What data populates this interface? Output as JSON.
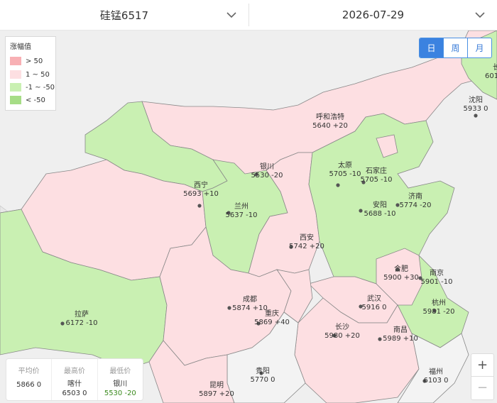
{
  "header": {
    "product": "硅锰6517",
    "date": "2026-07-29"
  },
  "legend": {
    "title": "涨幅值",
    "items": [
      {
        "label": "> 50",
        "color": "#f8b0b4"
      },
      {
        "label": "1 ~ 50",
        "color": "#fddfe2"
      },
      {
        "label": "-1 ~ -50",
        "color": "#c9f0b2"
      },
      {
        "label": "< -50",
        "color": "#a6dd86"
      }
    ]
  },
  "period_buttons": [
    {
      "label": "日",
      "active": true
    },
    {
      "label": "周",
      "active": false
    },
    {
      "label": "月",
      "active": false
    }
  ],
  "cities": [
    {
      "name": "呼和浩特",
      "price": "5640",
      "change": "+20"
    },
    {
      "name": "沈阳",
      "price": "5933",
      "change": "0"
    },
    {
      "name": "银川",
      "price": "5530",
      "change": "-20"
    },
    {
      "name": "太原",
      "price": "5705",
      "change": "-10"
    },
    {
      "name": "石家庄",
      "price": "5705",
      "change": "-10"
    },
    {
      "name": "西宁",
      "price": "5693",
      "change": "+10"
    },
    {
      "name": "济南",
      "price": "5774",
      "change": "-20"
    },
    {
      "name": "兰州",
      "price": "5637",
      "change": "-10"
    },
    {
      "name": "安阳",
      "price": "5688",
      "change": "-10"
    },
    {
      "name": "西安",
      "price": "5742",
      "change": "+20"
    },
    {
      "name": "合肥",
      "price": "5900",
      "change": "+30"
    },
    {
      "name": "南京",
      "price": "5901",
      "change": "-10"
    },
    {
      "name": "成都",
      "price": "5874",
      "change": "+10"
    },
    {
      "name": "武汉",
      "price": "5916",
      "change": "0"
    },
    {
      "name": "杭州",
      "price": "5981",
      "change": "-20"
    },
    {
      "name": "拉萨",
      "price": "6172",
      "change": "-10"
    },
    {
      "name": "重庆",
      "price": "5869",
      "change": "+40"
    },
    {
      "name": "长沙",
      "price": "5980",
      "change": "+20"
    },
    {
      "name": "南昌",
      "price": "5989",
      "change": "+10"
    },
    {
      "name": "贵阳",
      "price": "5770",
      "change": "0"
    },
    {
      "name": "福州",
      "price": "6103",
      "change": "0"
    },
    {
      "name": "昆明",
      "price": "5897",
      "change": "+20"
    }
  ],
  "edge_label": {
    "partial_name": "长",
    "partial_price": "601"
  },
  "stats": {
    "avg": {
      "label": "平均价",
      "value": "5866 0"
    },
    "high": {
      "label": "最高价",
      "city": "喀什",
      "value": "6503 0"
    },
    "low": {
      "label": "最低价",
      "city": "银川",
      "value": "5530 -20"
    }
  },
  "zoom": {
    "in": "+",
    "out": "−"
  }
}
